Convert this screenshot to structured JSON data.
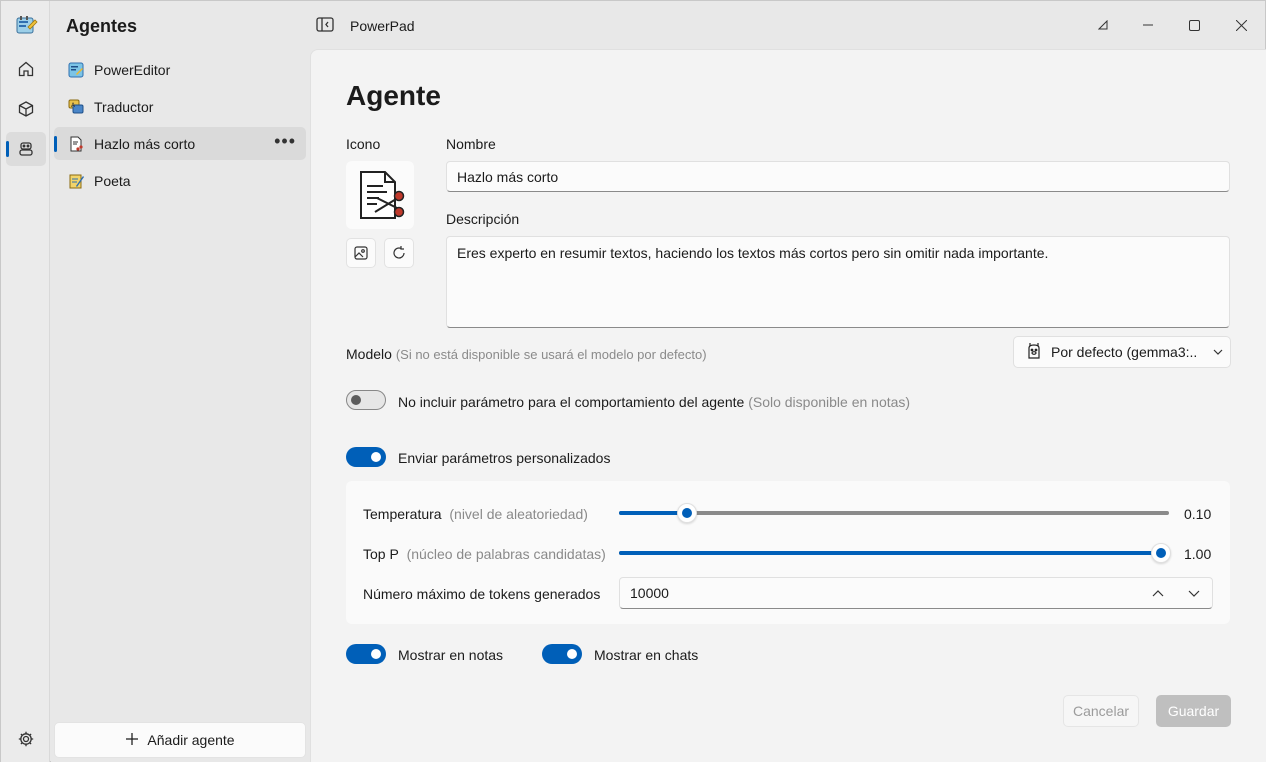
{
  "app": {
    "title": "PowerPad"
  },
  "agents_panel": {
    "title": "Agentes",
    "items": [
      {
        "label": "PowerEditor",
        "icon": "power-editor-icon"
      },
      {
        "label": "Traductor",
        "icon": "translator-icon"
      },
      {
        "label": "Hazlo más corto",
        "icon": "scissors-document-icon",
        "selected": true
      },
      {
        "label": "Poeta",
        "icon": "poet-icon"
      }
    ],
    "more_label": "•••",
    "add_button": "Añadir agente"
  },
  "editor": {
    "heading": "Agente",
    "icon_label": "Icono",
    "name_label": "Nombre",
    "name_value": "Hazlo más corto",
    "description_label": "Descripción",
    "description_value": "Eres experto en resumir textos, haciendo los textos más cortos pero sin omitir nada importante.",
    "model_label": "Modelo",
    "model_hint": "(Si no está disponible se usará el modelo por defecto)",
    "model_selected": "Por defecto (gemma3:...",
    "no_param_toggle": {
      "label": "No incluir parámetro para el comportamiento del agente",
      "hint": "(Solo disponible en notas)",
      "on": false
    },
    "custom_params_toggle": {
      "label": "Enviar parámetros personalizados",
      "on": true
    },
    "temperature": {
      "label": "Temperatura",
      "hint": "(nivel de aleatoriedad)",
      "value_text": "0.10",
      "fraction": 0.113
    },
    "top_p": {
      "label": "Top P",
      "hint": "(núcleo de palabras candidatas)",
      "value_text": "1.00",
      "fraction": 1.0
    },
    "max_tokens": {
      "label": "Número máximo de tokens generados",
      "value": "10000"
    },
    "show_in_notes": {
      "label": "Mostrar en notas",
      "on": true
    },
    "show_in_chats": {
      "label": "Mostrar en chats",
      "on": true
    },
    "cancel_button": "Cancelar",
    "save_button": "Guardar"
  },
  "colors": {
    "accent": "#005fb8"
  }
}
